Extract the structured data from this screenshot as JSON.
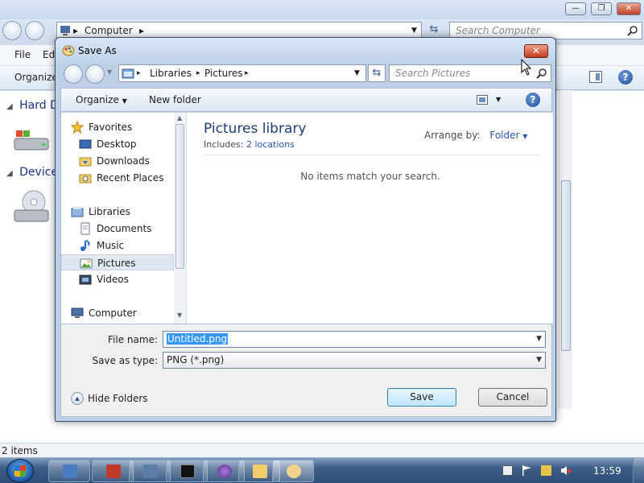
{
  "background_window": {
    "address_segment": "Computer",
    "search_placeholder": "Search Computer",
    "menu": [
      "File",
      "Ed"
    ],
    "organize": "Organize",
    "groups": [
      "Hard D",
      "Device"
    ],
    "status": "2 items"
  },
  "dialog": {
    "title": "Save As",
    "address": [
      "Libraries",
      "Pictures"
    ],
    "search_placeholder": "Search Pictures",
    "toolbar": {
      "organize": "Organize",
      "new_folder": "New folder"
    },
    "nav": {
      "favorites": "Favorites",
      "favorites_items": [
        "Desktop",
        "Downloads",
        "Recent Places"
      ],
      "libraries": "Libraries",
      "libraries_items": [
        "Documents",
        "Music",
        "Pictures",
        "Videos"
      ],
      "selected": "Pictures",
      "computer": "Computer"
    },
    "library": {
      "title": "Pictures library",
      "includes_label": "Includes:",
      "includes_link": "2 locations",
      "arrange_label": "Arrange by:",
      "arrange_value": "Folder",
      "empty_message": "No items match your search."
    },
    "file_name_label": "File name:",
    "file_name_value": "Untitled.png",
    "save_type_label": "Save as type:",
    "save_type_value": "PNG (*.png)",
    "hide_folders": "Hide Folders",
    "save_button": "Save",
    "cancel_button": "Cancel"
  },
  "taskbar": {
    "clock": "13:59"
  },
  "colors": {
    "accent_link": "#2a55b3",
    "library_title": "#1e3c76",
    "selection": "#3399ff",
    "close_red": "#c53b21"
  }
}
